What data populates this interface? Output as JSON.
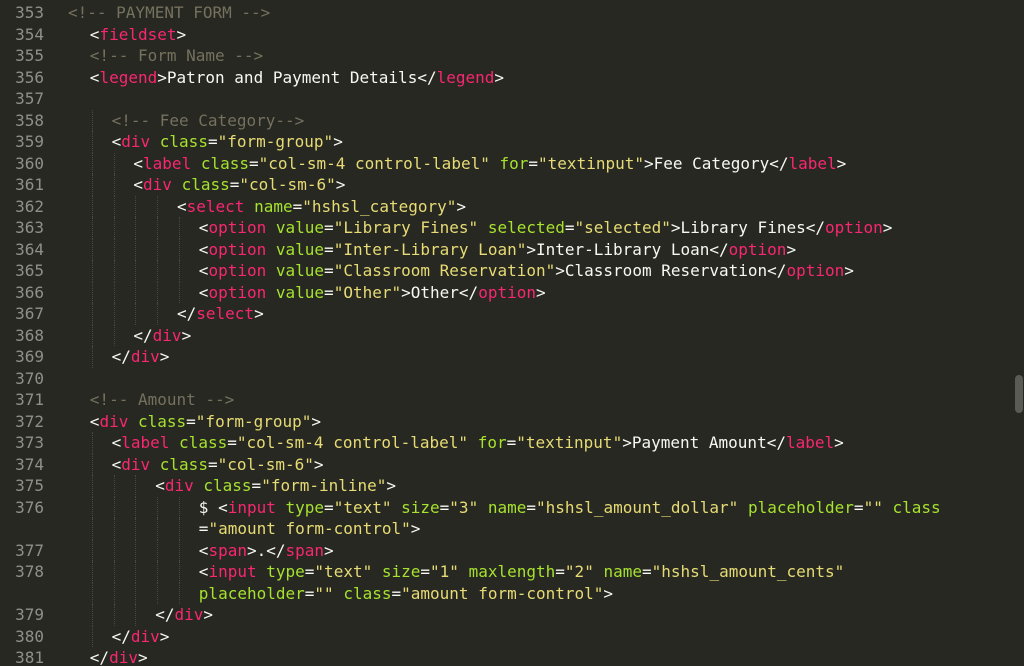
{
  "editor": {
    "theme": "monokai",
    "colors": {
      "background": "#272822",
      "comment": "#75715e",
      "tag": "#f92672",
      "attribute": "#a6e22e",
      "string": "#e6db74",
      "text": "#f8f8f2",
      "line_number": "#8f908a"
    },
    "lines": [
      {
        "number": "353",
        "indent": 0,
        "tokens": [
          [
            "c",
            "<!-- PAYMENT FORM -->"
          ]
        ]
      },
      {
        "number": "354",
        "indent": 2,
        "tokens": [
          [
            "p",
            "<"
          ],
          [
            "t",
            "fieldset"
          ],
          [
            "p",
            ">"
          ]
        ]
      },
      {
        "number": "355",
        "indent": 2,
        "tokens": [
          [
            "c",
            "<!-- Form Name -->"
          ]
        ]
      },
      {
        "number": "356",
        "indent": 2,
        "tokens": [
          [
            "p",
            "<"
          ],
          [
            "t",
            "legend"
          ],
          [
            "p",
            ">Patron and Payment Details</"
          ],
          [
            "t",
            "legend"
          ],
          [
            "p",
            ">"
          ]
        ]
      },
      {
        "number": "357",
        "indent": 0,
        "tokens": []
      },
      {
        "number": "358",
        "indent": 4,
        "tokens": [
          [
            "c",
            "<!-- Fee Category-->"
          ]
        ]
      },
      {
        "number": "359",
        "indent": 4,
        "tokens": [
          [
            "p",
            "<"
          ],
          [
            "t",
            "div"
          ],
          [
            "p",
            " "
          ],
          [
            "a",
            "class"
          ],
          [
            "p",
            "="
          ],
          [
            "s",
            "\"form-group\""
          ],
          [
            "p",
            ">"
          ]
        ]
      },
      {
        "number": "360",
        "indent": 6,
        "tokens": [
          [
            "p",
            "<"
          ],
          [
            "t",
            "label"
          ],
          [
            "p",
            " "
          ],
          [
            "a",
            "class"
          ],
          [
            "p",
            "="
          ],
          [
            "s",
            "\"col-sm-4 control-label\""
          ],
          [
            "p",
            " "
          ],
          [
            "a",
            "for"
          ],
          [
            "p",
            "="
          ],
          [
            "s",
            "\"textinput\""
          ],
          [
            "p",
            ">Fee Category</"
          ],
          [
            "t",
            "label"
          ],
          [
            "p",
            ">"
          ]
        ]
      },
      {
        "number": "361",
        "indent": 6,
        "tokens": [
          [
            "p",
            "<"
          ],
          [
            "t",
            "div"
          ],
          [
            "p",
            " "
          ],
          [
            "a",
            "class"
          ],
          [
            "p",
            "="
          ],
          [
            "s",
            "\"col-sm-6\""
          ],
          [
            "p",
            ">"
          ]
        ]
      },
      {
        "number": "362",
        "indent": 10,
        "tokens": [
          [
            "p",
            "<"
          ],
          [
            "t",
            "select"
          ],
          [
            "p",
            " "
          ],
          [
            "a",
            "name"
          ],
          [
            "p",
            "="
          ],
          [
            "s",
            "\"hshsl_category\""
          ],
          [
            "p",
            ">"
          ]
        ]
      },
      {
        "number": "363",
        "indent": 12,
        "tokens": [
          [
            "p",
            "<"
          ],
          [
            "t",
            "option"
          ],
          [
            "p",
            " "
          ],
          [
            "a",
            "value"
          ],
          [
            "p",
            "="
          ],
          [
            "s",
            "\"Library Fines\""
          ],
          [
            "p",
            " "
          ],
          [
            "a",
            "selected"
          ],
          [
            "p",
            "="
          ],
          [
            "s",
            "\"selected\""
          ],
          [
            "p",
            ">Library Fines</"
          ],
          [
            "t",
            "option"
          ],
          [
            "p",
            ">"
          ]
        ]
      },
      {
        "number": "364",
        "indent": 12,
        "tokens": [
          [
            "p",
            "<"
          ],
          [
            "t",
            "option"
          ],
          [
            "p",
            " "
          ],
          [
            "a",
            "value"
          ],
          [
            "p",
            "="
          ],
          [
            "s",
            "\"Inter-Library Loan\""
          ],
          [
            "p",
            ">Inter-Library Loan</"
          ],
          [
            "t",
            "option"
          ],
          [
            "p",
            ">"
          ]
        ]
      },
      {
        "number": "365",
        "indent": 12,
        "tokens": [
          [
            "p",
            "<"
          ],
          [
            "t",
            "option"
          ],
          [
            "p",
            " "
          ],
          [
            "a",
            "value"
          ],
          [
            "p",
            "="
          ],
          [
            "s",
            "\"Classroom Reservation\""
          ],
          [
            "p",
            ">Classroom Reservation</"
          ],
          [
            "t",
            "option"
          ],
          [
            "p",
            ">"
          ]
        ]
      },
      {
        "number": "366",
        "indent": 12,
        "tokens": [
          [
            "p",
            "<"
          ],
          [
            "t",
            "option"
          ],
          [
            "p",
            " "
          ],
          [
            "a",
            "value"
          ],
          [
            "p",
            "="
          ],
          [
            "s",
            "\"Other\""
          ],
          [
            "p",
            ">Other</"
          ],
          [
            "t",
            "option"
          ],
          [
            "p",
            ">"
          ]
        ]
      },
      {
        "number": "367",
        "indent": 10,
        "tokens": [
          [
            "p",
            "</"
          ],
          [
            "t",
            "select"
          ],
          [
            "p",
            ">"
          ]
        ]
      },
      {
        "number": "368",
        "indent": 6,
        "tokens": [
          [
            "p",
            "</"
          ],
          [
            "t",
            "div"
          ],
          [
            "p",
            ">"
          ]
        ]
      },
      {
        "number": "369",
        "indent": 4,
        "tokens": [
          [
            "p",
            "</"
          ],
          [
            "t",
            "div"
          ],
          [
            "p",
            ">"
          ]
        ]
      },
      {
        "number": "370",
        "indent": 0,
        "tokens": []
      },
      {
        "number": "371",
        "indent": 2,
        "tokens": [
          [
            "c",
            "<!-- Amount -->"
          ]
        ]
      },
      {
        "number": "372",
        "indent": 2,
        "tokens": [
          [
            "p",
            "<"
          ],
          [
            "t",
            "div"
          ],
          [
            "p",
            " "
          ],
          [
            "a",
            "class"
          ],
          [
            "p",
            "="
          ],
          [
            "s",
            "\"form-group\""
          ],
          [
            "p",
            ">"
          ]
        ]
      },
      {
        "number": "373",
        "indent": 4,
        "tokens": [
          [
            "p",
            "<"
          ],
          [
            "t",
            "label"
          ],
          [
            "p",
            " "
          ],
          [
            "a",
            "class"
          ],
          [
            "p",
            "="
          ],
          [
            "s",
            "\"col-sm-4 control-label\""
          ],
          [
            "p",
            " "
          ],
          [
            "a",
            "for"
          ],
          [
            "p",
            "="
          ],
          [
            "s",
            "\"textinput\""
          ],
          [
            "p",
            ">Payment Amount</"
          ],
          [
            "t",
            "label"
          ],
          [
            "p",
            ">"
          ]
        ]
      },
      {
        "number": "374",
        "indent": 4,
        "tokens": [
          [
            "p",
            "<"
          ],
          [
            "t",
            "div"
          ],
          [
            "p",
            " "
          ],
          [
            "a",
            "class"
          ],
          [
            "p",
            "="
          ],
          [
            "s",
            "\"col-sm-6\""
          ],
          [
            "p",
            ">"
          ]
        ]
      },
      {
        "number": "375",
        "indent": 8,
        "tokens": [
          [
            "p",
            "<"
          ],
          [
            "t",
            "div"
          ],
          [
            "p",
            " "
          ],
          [
            "a",
            "class"
          ],
          [
            "p",
            "="
          ],
          [
            "s",
            "\"form-inline\""
          ],
          [
            "p",
            ">"
          ]
        ]
      },
      {
        "number": "376",
        "indent": 12,
        "tokens": [
          [
            "p",
            "$ <"
          ],
          [
            "t",
            "input"
          ],
          [
            "p",
            " "
          ],
          [
            "a",
            "type"
          ],
          [
            "p",
            "="
          ],
          [
            "s",
            "\"text\""
          ],
          [
            "p",
            " "
          ],
          [
            "a",
            "size"
          ],
          [
            "p",
            "="
          ],
          [
            "s",
            "\"3\""
          ],
          [
            "p",
            " "
          ],
          [
            "a",
            "name"
          ],
          [
            "p",
            "="
          ],
          [
            "s",
            "\"hshsl_amount_dollar\""
          ],
          [
            "p",
            " "
          ],
          [
            "a",
            "placeholder"
          ],
          [
            "p",
            "="
          ],
          [
            "s",
            "\"\""
          ],
          [
            "p",
            " "
          ],
          [
            "a",
            "class"
          ]
        ]
      },
      {
        "number": "",
        "indent": 12,
        "tokens": [
          [
            "p",
            "="
          ],
          [
            "s",
            "\"amount form-control\""
          ],
          [
            "p",
            ">"
          ]
        ]
      },
      {
        "number": "377",
        "indent": 12,
        "tokens": [
          [
            "p",
            "<"
          ],
          [
            "t",
            "span"
          ],
          [
            "p",
            ">.</"
          ],
          [
            "t",
            "span"
          ],
          [
            "p",
            ">"
          ]
        ]
      },
      {
        "number": "378",
        "indent": 12,
        "tokens": [
          [
            "p",
            "<"
          ],
          [
            "t",
            "input"
          ],
          [
            "p",
            " "
          ],
          [
            "a",
            "type"
          ],
          [
            "p",
            "="
          ],
          [
            "s",
            "\"text\""
          ],
          [
            "p",
            " "
          ],
          [
            "a",
            "size"
          ],
          [
            "p",
            "="
          ],
          [
            "s",
            "\"1\""
          ],
          [
            "p",
            " "
          ],
          [
            "a",
            "maxlength"
          ],
          [
            "p",
            "="
          ],
          [
            "s",
            "\"2\""
          ],
          [
            "p",
            " "
          ],
          [
            "a",
            "name"
          ],
          [
            "p",
            "="
          ],
          [
            "s",
            "\"hshsl_amount_cents\""
          ]
        ]
      },
      {
        "number": "",
        "indent": 12,
        "tokens": [
          [
            "a",
            "placeholder"
          ],
          [
            "p",
            "="
          ],
          [
            "s",
            "\"\""
          ],
          [
            "p",
            " "
          ],
          [
            "a",
            "class"
          ],
          [
            "p",
            "="
          ],
          [
            "s",
            "\"amount form-control\""
          ],
          [
            "p",
            ">"
          ]
        ]
      },
      {
        "number": "379",
        "indent": 8,
        "tokens": [
          [
            "p",
            "</"
          ],
          [
            "t",
            "div"
          ],
          [
            "p",
            ">"
          ]
        ]
      },
      {
        "number": "380",
        "indent": 4,
        "tokens": [
          [
            "p",
            "</"
          ],
          [
            "t",
            "div"
          ],
          [
            "p",
            ">"
          ]
        ]
      },
      {
        "number": "381",
        "indent": 2,
        "tokens": [
          [
            "p",
            "</"
          ],
          [
            "t",
            "div"
          ],
          [
            "p",
            ">"
          ]
        ]
      }
    ]
  }
}
